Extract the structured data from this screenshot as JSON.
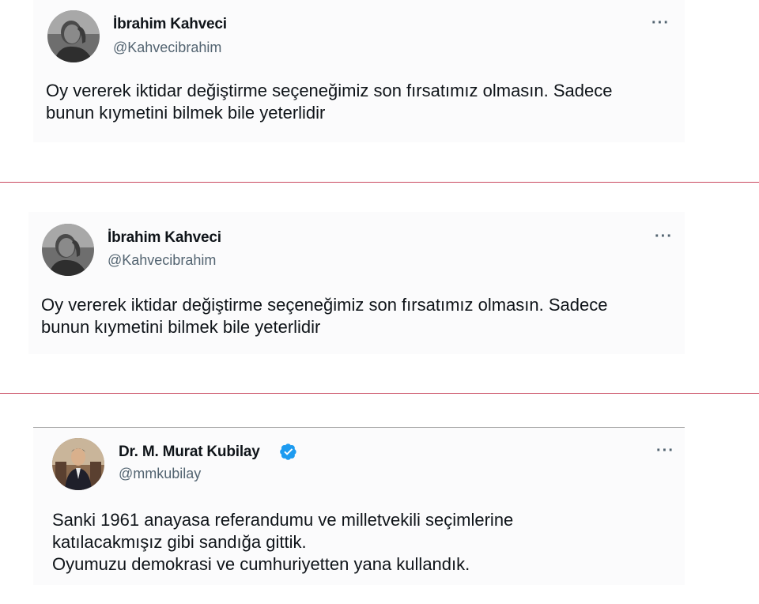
{
  "tweets": [
    {
      "name": "İbrahim Kahveci",
      "handle": "@Kahvecibrahim",
      "verified": false,
      "more_icon": "more-dots-icon",
      "text_lines": [
        "Oy vererek iktidar değiştirme seçeneğimiz son fırsatımız olmasın. Sadece",
        "bunun kıymetini bilmek bile yeterlidir"
      ]
    },
    {
      "name": "İbrahim Kahveci",
      "handle": "@Kahvecibrahim",
      "verified": false,
      "more_icon": "more-dots-icon",
      "text_lines": [
        "Oy vererek iktidar değiştirme seçeneğimiz son fırsatımız olmasın. Sadece",
        "bunun kıymetini bilmek bile yeterlidir"
      ]
    },
    {
      "name": "Dr. M. Murat Kubilay",
      "handle": "@mmkubilay",
      "verified": true,
      "verified_icon": "verified-badge-icon",
      "more_icon": "more-dots-icon",
      "text_lines": [
        "Sanki 1961 anayasa referandumu ve milletvekili seçimlerine",
        "katılacakmışız gibi sandığa gittik.",
        "Oyumuzu demokrasi ve cumhuriyetten yana kullandık."
      ]
    }
  ],
  "colors": {
    "name": "#0f1419",
    "handle": "#536471",
    "verified": "#1d9bf0",
    "divider": "#c94a60",
    "card_bg": "#fbfbfc"
  },
  "more_glyph": "···"
}
